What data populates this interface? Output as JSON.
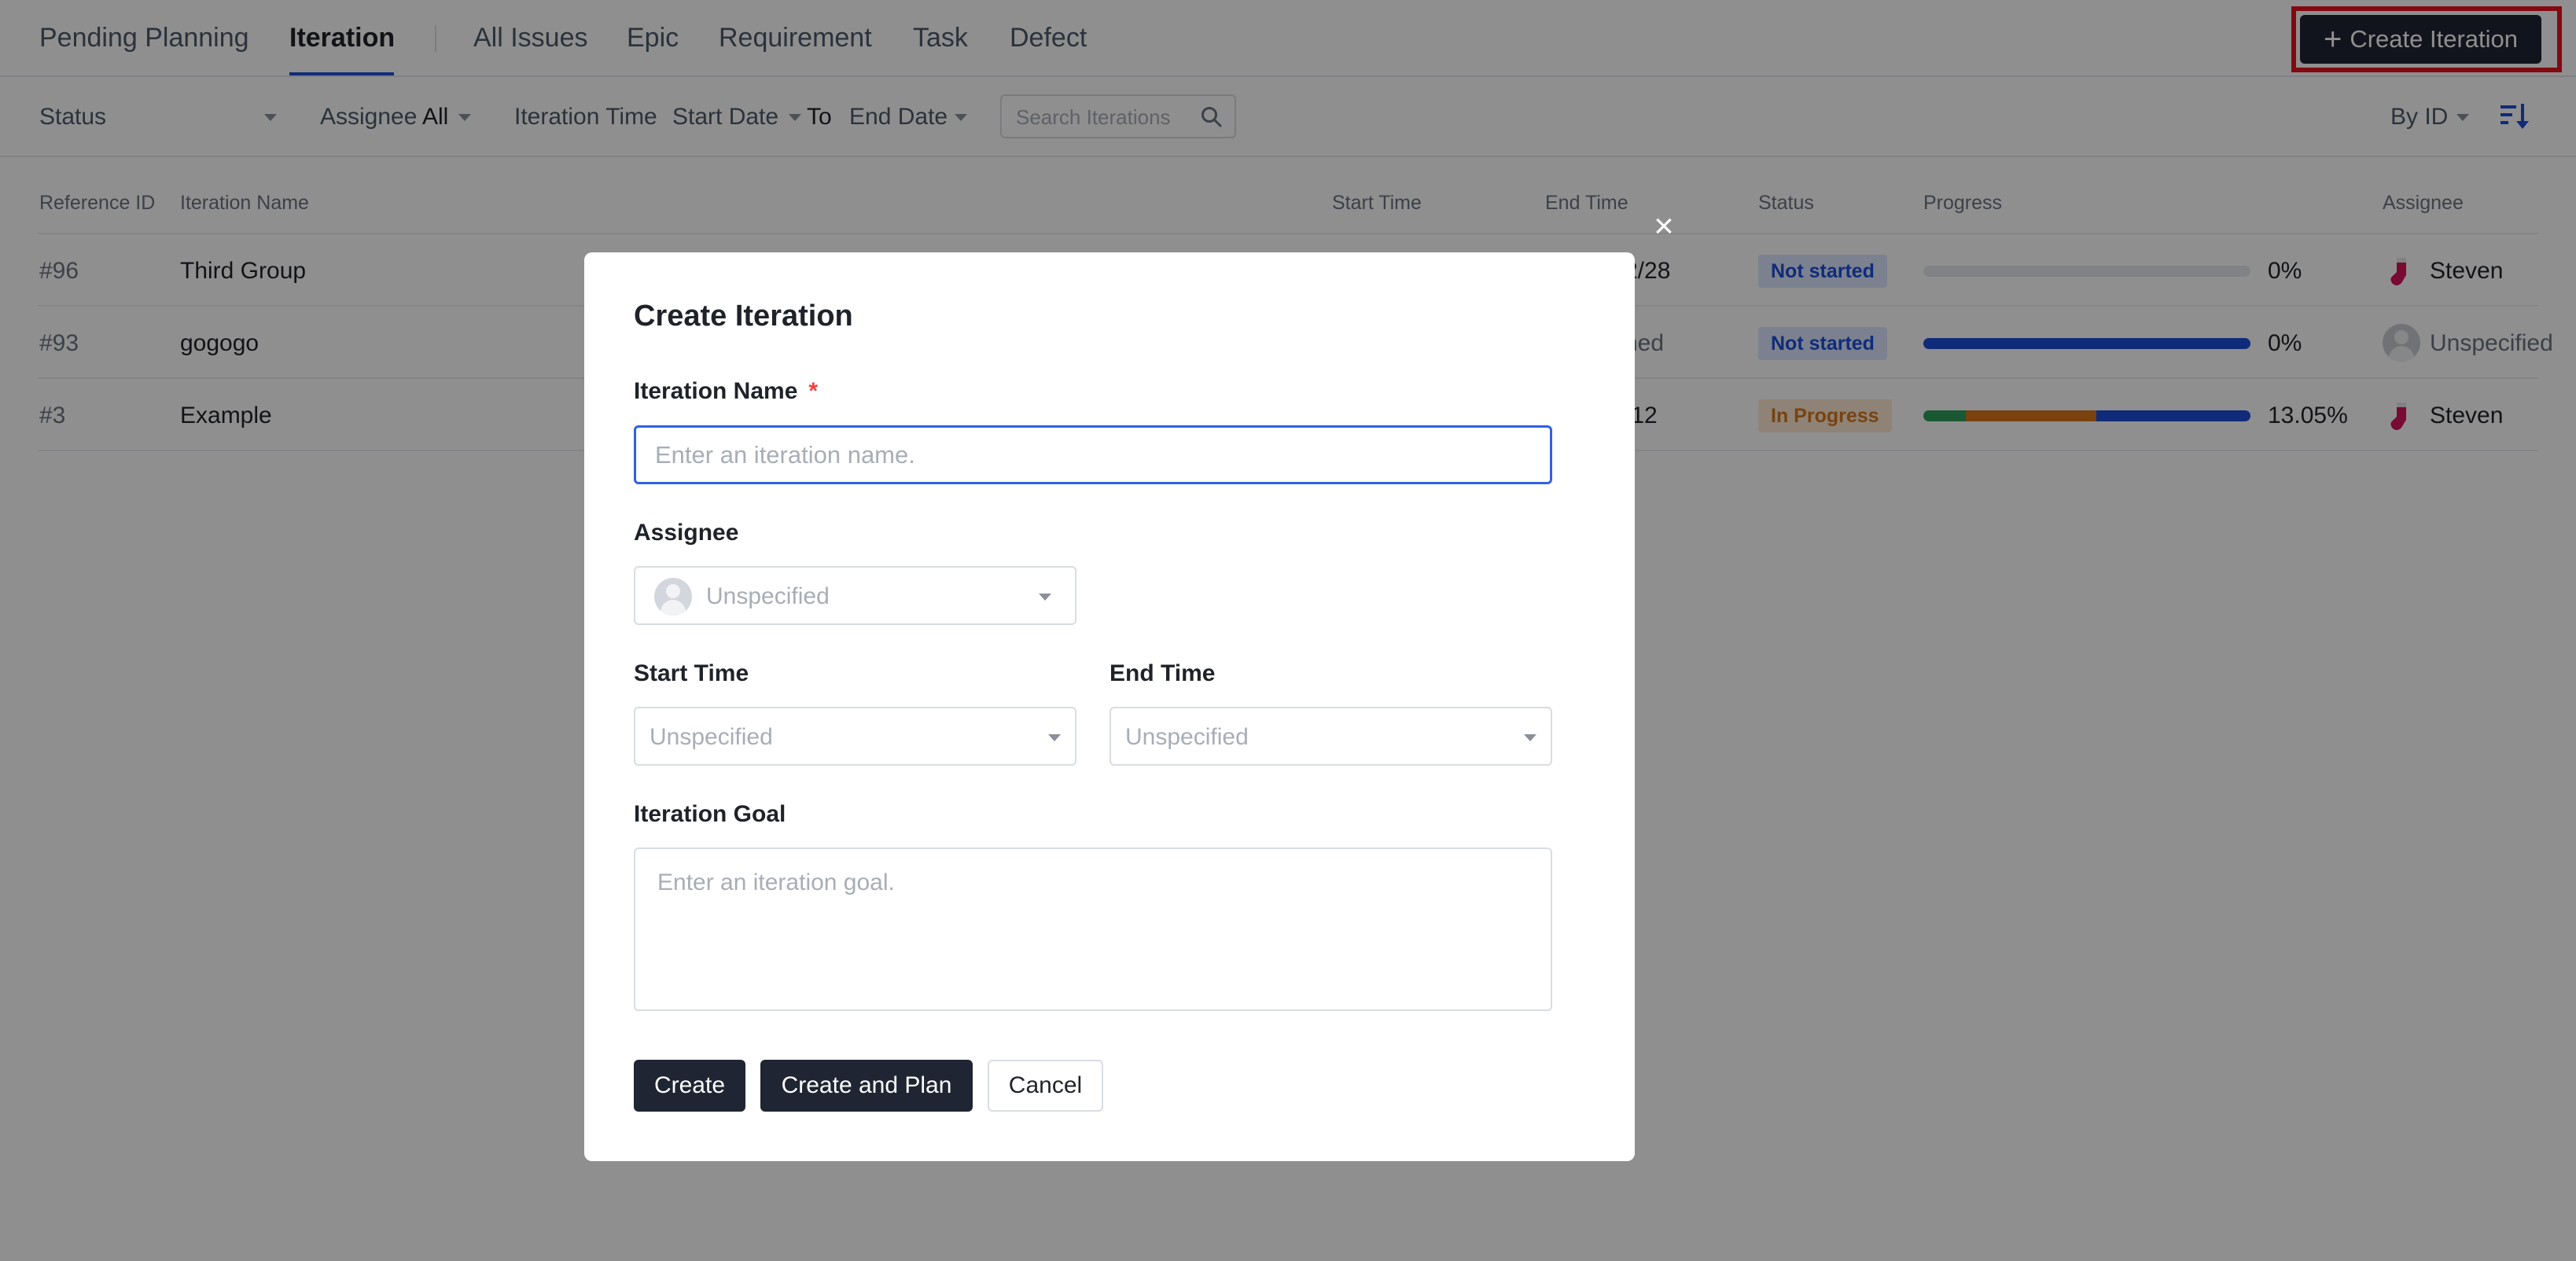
{
  "nav": {
    "tabs": [
      {
        "label": "Pending Planning"
      },
      {
        "label": "Iteration"
      },
      {
        "label": "All Issues"
      },
      {
        "label": "Epic"
      },
      {
        "label": "Requirement"
      },
      {
        "label": "Task"
      },
      {
        "label": "Defect"
      }
    ],
    "active_tab": "Iteration",
    "create_button_label": "Create Iteration"
  },
  "filters": {
    "status_label": "Status",
    "assignee_label": "Assignee",
    "assignee_value": "All",
    "iteration_time_label": "Iteration Time",
    "start_date": "Start Date",
    "to_label": "To",
    "end_date": "End Date",
    "search_placeholder": "Search Iterations",
    "sort_label": "By ID"
  },
  "table": {
    "headers": {
      "ref_id": "Reference ID",
      "name": "Iteration Name",
      "start_time": "Start Time",
      "end_time": "End Time",
      "status": "Status",
      "progress": "Progress",
      "assignee": "Assignee"
    },
    "rows": [
      {
        "ref_id": "#96",
        "name": "Third Group",
        "end_time_partial": "2/28",
        "status": "Not started",
        "progress_text": "0%",
        "progress_fraction": 0.0,
        "assignee": "Steven"
      },
      {
        "ref_id": "#93",
        "name": "gogogo",
        "end_time_partial": "hed",
        "status": "Not started",
        "progress_text": "0%",
        "progress_fraction": 1.0,
        "assignee": "Unspecified"
      },
      {
        "ref_id": "#3",
        "name": "Example",
        "end_time_partial": "/12",
        "status": "In Progress",
        "progress_text": "13.05%",
        "progress_fraction": 0.1305,
        "assignee": "Steven"
      }
    ],
    "colors": {
      "not_started_badge": "#1e4ed8",
      "in_progress_badge": "#d8771c",
      "progress_blue": "#1e4ed8",
      "progress_green": "#2e9e5b",
      "progress_orange": "#d8771c"
    }
  },
  "modal": {
    "title": "Create Iteration",
    "name_label": "Iteration Name",
    "name_required_mark": "*",
    "name_value": "",
    "name_placeholder": "Enter an iteration name.",
    "assignee_label": "Assignee",
    "assignee_value": "Unspecified",
    "start_time_label": "Start Time",
    "start_time_value": "Unspecified",
    "end_time_label": "End Time",
    "end_time_value": "Unspecified",
    "goal_label": "Iteration Goal",
    "goal_placeholder": "Enter an iteration goal.",
    "create_label": "Create",
    "create_and_plan_label": "Create and Plan",
    "cancel_label": "Cancel"
  }
}
